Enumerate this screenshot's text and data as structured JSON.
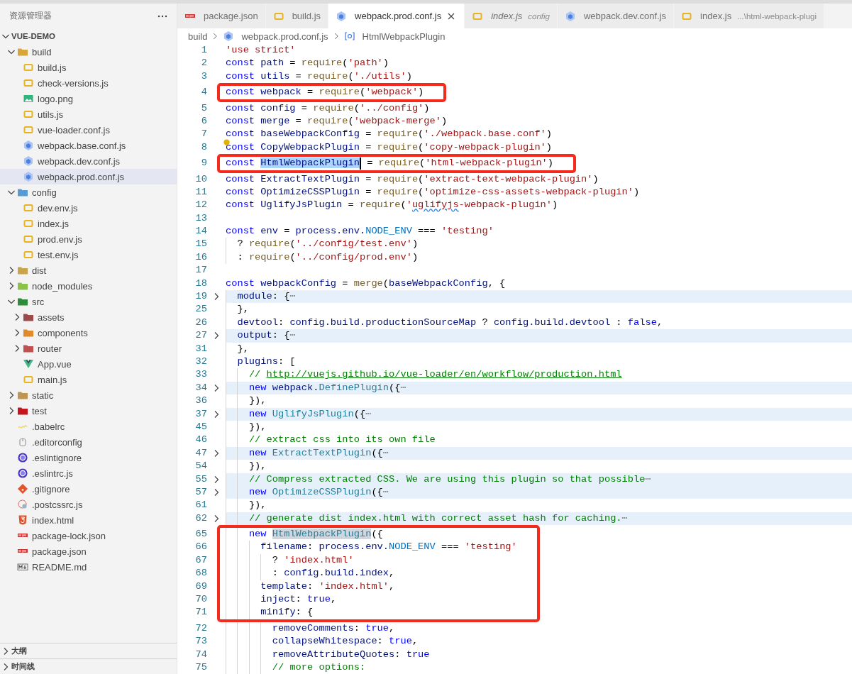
{
  "explorer": {
    "title": "资源管理器",
    "root": {
      "label": "VUE-DEMO",
      "expanded": true,
      "children": [
        {
          "label": "build",
          "kind": "folder",
          "color": "#d9a53a",
          "expanded": true,
          "selected": false,
          "children": [
            {
              "label": "build.js",
              "kind": "js",
              "selected": false
            },
            {
              "label": "check-versions.js",
              "kind": "js",
              "selected": false
            },
            {
              "label": "logo.png",
              "kind": "image",
              "selected": false
            },
            {
              "label": "utils.js",
              "kind": "js",
              "selected": false
            },
            {
              "label": "vue-loader.conf.js",
              "kind": "js",
              "selected": false
            },
            {
              "label": "webpack.base.conf.js",
              "kind": "webpack",
              "selected": false
            },
            {
              "label": "webpack.dev.conf.js",
              "kind": "webpack",
              "selected": false
            },
            {
              "label": "webpack.prod.conf.js",
              "kind": "webpack",
              "selected": true
            }
          ]
        },
        {
          "label": "config",
          "kind": "folder",
          "color": "#5b9bd5",
          "expanded": true,
          "selected": false,
          "children": [
            {
              "label": "dev.env.js",
              "kind": "js",
              "selected": false
            },
            {
              "label": "index.js",
              "kind": "js",
              "selected": false
            },
            {
              "label": "prod.env.js",
              "kind": "js",
              "selected": false
            },
            {
              "label": "test.env.js",
              "kind": "js",
              "selected": false
            }
          ]
        },
        {
          "label": "dist",
          "kind": "folder",
          "color": "#c9a54a",
          "expanded": false,
          "selected": false
        },
        {
          "label": "node_modules",
          "kind": "folder",
          "color": "#8bc34a",
          "expanded": false,
          "selected": false
        },
        {
          "label": "src",
          "kind": "folder",
          "color": "#2e8b3a",
          "expanded": true,
          "selected": false,
          "children": [
            {
              "label": "assets",
              "kind": "folder",
              "color": "#9c4a4a",
              "expanded": false,
              "selected": false
            },
            {
              "label": "components",
              "kind": "folder",
              "color": "#e08a2c",
              "expanded": false,
              "selected": false
            },
            {
              "label": "router",
              "kind": "folder",
              "color": "#c0504d",
              "expanded": false,
              "selected": false
            },
            {
              "label": "App.vue",
              "kind": "vue",
              "selected": false
            },
            {
              "label": "main.js",
              "kind": "js",
              "selected": false
            }
          ]
        },
        {
          "label": "static",
          "kind": "folder",
          "color": "#c09553",
          "expanded": false,
          "selected": false
        },
        {
          "label": "test",
          "kind": "folder",
          "color": "#c4161c",
          "expanded": false,
          "selected": false
        },
        {
          "label": ".babelrc",
          "kind": "babel",
          "selected": false
        },
        {
          "label": ".editorconfig",
          "kind": "editorconfig",
          "selected": false
        },
        {
          "label": ".eslintignore",
          "kind": "eslint",
          "selected": false
        },
        {
          "label": ".eslintrc.js",
          "kind": "eslint",
          "selected": false
        },
        {
          "label": ".gitignore",
          "kind": "git",
          "selected": false
        },
        {
          "label": ".postcssrc.js",
          "kind": "postcss",
          "selected": false
        },
        {
          "label": "index.html",
          "kind": "html",
          "selected": false
        },
        {
          "label": "package-lock.json",
          "kind": "npm",
          "selected": false
        },
        {
          "label": "package.json",
          "kind": "npm",
          "selected": false
        },
        {
          "label": "README.md",
          "kind": "markdown",
          "selected": false
        }
      ]
    },
    "panels": [
      {
        "label": "大纲",
        "expanded": false
      },
      {
        "label": "时间线",
        "expanded": false
      }
    ]
  },
  "tabs": [
    {
      "label": "package.json",
      "kind": "npm",
      "selected": false,
      "preview": false
    },
    {
      "label": "build.js",
      "kind": "js",
      "selected": false,
      "preview": false
    },
    {
      "label": "webpack.prod.conf.js",
      "kind": "webpack",
      "selected": true,
      "preview": false
    },
    {
      "label": "index.js",
      "description": "config",
      "kind": "js",
      "selected": false,
      "preview": true
    },
    {
      "label": "webpack.dev.conf.js",
      "kind": "webpack",
      "selected": false,
      "preview": false
    },
    {
      "label": "index.js",
      "description": "...\\html-webpack-plugi",
      "kind": "js",
      "selected": false,
      "preview": false
    }
  ],
  "breadcrumbs": [
    {
      "label": "build",
      "kind": "folder"
    },
    {
      "label": "webpack.prod.conf.js",
      "kind": "webpack"
    },
    {
      "label": "HtmlWebpackPlugin",
      "kind": "symbol"
    }
  ],
  "editor": {
    "lines": [
      {
        "number": "1",
        "boxed": false,
        "folded": false,
        "tokens": [
          {
            "kind": "string",
            "text": "'use strict'"
          }
        ]
      },
      {
        "number": "2",
        "boxed": false,
        "folded": false,
        "tokens": [
          {
            "kind": "keyword",
            "text": "const "
          },
          {
            "kind": "variable",
            "text": "path"
          },
          {
            "kind": "plain",
            "text": " = "
          },
          {
            "kind": "function",
            "text": "require"
          },
          {
            "kind": "plain",
            "text": "("
          },
          {
            "kind": "string",
            "text": "'path'"
          },
          {
            "kind": "plain",
            "text": ")"
          }
        ]
      },
      {
        "number": "3",
        "boxed": false,
        "folded": false,
        "tokens": [
          {
            "kind": "keyword",
            "text": "const "
          },
          {
            "kind": "variable",
            "text": "utils"
          },
          {
            "kind": "plain",
            "text": " = "
          },
          {
            "kind": "function",
            "text": "require"
          },
          {
            "kind": "plain",
            "text": "("
          },
          {
            "kind": "string",
            "text": "'./utils'"
          },
          {
            "kind": "plain",
            "text": ")"
          }
        ]
      },
      {
        "number": "4",
        "boxed": true,
        "folded": false,
        "tokens": [
          {
            "kind": "keyword",
            "text": "const "
          },
          {
            "kind": "variable",
            "text": "webpack"
          },
          {
            "kind": "plain",
            "text": " = "
          },
          {
            "kind": "function",
            "text": "require"
          },
          {
            "kind": "plain",
            "text": "("
          },
          {
            "kind": "string",
            "text": "'webpack'"
          },
          {
            "kind": "plain",
            "text": ")"
          }
        ]
      },
      {
        "number": "5",
        "boxed": false,
        "folded": false,
        "tokens": [
          {
            "kind": "keyword",
            "text": "const "
          },
          {
            "kind": "variable",
            "text": "config"
          },
          {
            "kind": "plain",
            "text": " = "
          },
          {
            "kind": "function",
            "text": "require"
          },
          {
            "kind": "plain",
            "text": "("
          },
          {
            "kind": "string",
            "text": "'../config'"
          },
          {
            "kind": "plain",
            "text": ")"
          }
        ]
      },
      {
        "number": "6",
        "boxed": false,
        "folded": false,
        "tokens": [
          {
            "kind": "keyword",
            "text": "const "
          },
          {
            "kind": "variable",
            "text": "merge"
          },
          {
            "kind": "plain",
            "text": " = "
          },
          {
            "kind": "function",
            "text": "require"
          },
          {
            "kind": "plain",
            "text": "("
          },
          {
            "kind": "string",
            "text": "'webpack-merge'"
          },
          {
            "kind": "plain",
            "text": ")"
          }
        ]
      },
      {
        "number": "7",
        "boxed": false,
        "folded": false,
        "tokens": [
          {
            "kind": "keyword",
            "text": "const "
          },
          {
            "kind": "variable",
            "text": "baseWebpackConfig"
          },
          {
            "kind": "plain",
            "text": " = "
          },
          {
            "kind": "function",
            "text": "require"
          },
          {
            "kind": "plain",
            "text": "("
          },
          {
            "kind": "string",
            "text": "'./webpack.base.conf'"
          },
          {
            "kind": "plain",
            "text": ")"
          }
        ]
      },
      {
        "number": "8",
        "boxed": false,
        "folded": false,
        "lightbulb": true,
        "tokens": [
          {
            "kind": "keyword",
            "text": "const "
          },
          {
            "kind": "variable",
            "text": "CopyWebpackPlugin"
          },
          {
            "kind": "plain",
            "text": " = "
          },
          {
            "kind": "function",
            "text": "require"
          },
          {
            "kind": "plain",
            "text": "("
          },
          {
            "kind": "string",
            "text": "'copy-webpack-plugin'"
          },
          {
            "kind": "plain",
            "text": ")"
          }
        ]
      },
      {
        "number": "9",
        "boxed": true,
        "folded": false,
        "tokens": [
          {
            "kind": "keyword",
            "text": "const "
          },
          {
            "kind": "variable",
            "text": "HtmlWebpackPlugin",
            "selected": true
          },
          {
            "kind": "plain",
            "text": " = "
          },
          {
            "kind": "function",
            "text": "require"
          },
          {
            "kind": "plain",
            "text": "("
          },
          {
            "kind": "string",
            "text": "'html-webpack-plugin'"
          },
          {
            "kind": "plain",
            "text": ")"
          }
        ]
      },
      {
        "number": "10",
        "boxed": false,
        "folded": false,
        "tokens": [
          {
            "kind": "keyword",
            "text": "const "
          },
          {
            "kind": "variable",
            "text": "ExtractTextPlugin"
          },
          {
            "kind": "plain",
            "text": " = "
          },
          {
            "kind": "function",
            "text": "require"
          },
          {
            "kind": "plain",
            "text": "("
          },
          {
            "kind": "string",
            "text": "'extract-text-webpack-plugin'"
          },
          {
            "kind": "plain",
            "text": ")"
          }
        ]
      },
      {
        "number": "11",
        "boxed": false,
        "folded": false,
        "tokens": [
          {
            "kind": "keyword",
            "text": "const "
          },
          {
            "kind": "variable",
            "text": "OptimizeCSSPlugin"
          },
          {
            "kind": "plain",
            "text": " = "
          },
          {
            "kind": "function",
            "text": "require"
          },
          {
            "kind": "plain",
            "text": "("
          },
          {
            "kind": "string",
            "text": "'optimize-css-assets-webpack-plugin'"
          },
          {
            "kind": "plain",
            "text": ")"
          }
        ]
      },
      {
        "number": "12",
        "boxed": false,
        "folded": false,
        "tokens": [
          {
            "kind": "keyword",
            "text": "const "
          },
          {
            "kind": "variable",
            "text": "UglifyJsPlugin"
          },
          {
            "kind": "plain",
            "text": " = "
          },
          {
            "kind": "function",
            "text": "require"
          },
          {
            "kind": "plain",
            "text": "("
          },
          {
            "kind": "string",
            "text": "'"
          },
          {
            "kind": "string",
            "text": "uglifyjs",
            "squiggle": true
          },
          {
            "kind": "string",
            "text": "-webpack-plugin'"
          },
          {
            "kind": "plain",
            "text": ")"
          }
        ]
      },
      {
        "number": "13",
        "boxed": false,
        "folded": false
      },
      {
        "number": "14",
        "boxed": false,
        "folded": false,
        "tokens": [
          {
            "kind": "keyword",
            "text": "const "
          },
          {
            "kind": "variable",
            "text": "env"
          },
          {
            "kind": "plain",
            "text": " = "
          },
          {
            "kind": "variable",
            "text": "process.env."
          },
          {
            "kind": "constant",
            "text": "NODE_ENV"
          },
          {
            "kind": "plain",
            "text": " === "
          },
          {
            "kind": "string",
            "text": "'testing'"
          }
        ]
      },
      {
        "number": "15",
        "boxed": false,
        "folded": false,
        "tokens": [
          {
            "kind": "plain",
            "text": "  ? "
          },
          {
            "kind": "function",
            "text": "require"
          },
          {
            "kind": "plain",
            "text": "("
          },
          {
            "kind": "string",
            "text": "'../config/test.env'"
          },
          {
            "kind": "plain",
            "text": ")"
          }
        ]
      },
      {
        "number": "16",
        "boxed": false,
        "folded": false,
        "tokens": [
          {
            "kind": "plain",
            "text": "  : "
          },
          {
            "kind": "function",
            "text": "require"
          },
          {
            "kind": "plain",
            "text": "("
          },
          {
            "kind": "string",
            "text": "'../config/prod.env'"
          },
          {
            "kind": "plain",
            "text": ")"
          }
        ]
      },
      {
        "number": "17",
        "boxed": false,
        "folded": false
      },
      {
        "number": "18",
        "boxed": false,
        "folded": false,
        "tokens": [
          {
            "kind": "keyword",
            "text": "const "
          },
          {
            "kind": "variable",
            "text": "webpackConfig"
          },
          {
            "kind": "plain",
            "text": " = "
          },
          {
            "kind": "function",
            "text": "merge"
          },
          {
            "kind": "plain",
            "text": "("
          },
          {
            "kind": "variable",
            "text": "baseWebpackConfig"
          },
          {
            "kind": "plain",
            "text": ", {"
          }
        ]
      },
      {
        "number": "19",
        "boxed": false,
        "folded": true,
        "tokens": [
          {
            "kind": "variable",
            "text": "  module"
          },
          {
            "kind": "plain",
            "text": ": {"
          },
          {
            "kind": "fold",
            "text": "⋯"
          }
        ]
      },
      {
        "number": "25",
        "boxed": false,
        "folded": false,
        "tokens": [
          {
            "kind": "plain",
            "text": "  },"
          }
        ]
      },
      {
        "number": "26",
        "boxed": false,
        "folded": false,
        "tokens": [
          {
            "kind": "variable",
            "text": "  devtool"
          },
          {
            "kind": "plain",
            "text": ": "
          },
          {
            "kind": "variable",
            "text": "config.build.productionSourceMap"
          },
          {
            "kind": "plain",
            "text": " ? "
          },
          {
            "kind": "variable",
            "text": "config.build.devtool"
          },
          {
            "kind": "plain",
            "text": " : "
          },
          {
            "kind": "keyword",
            "text": "false"
          },
          {
            "kind": "plain",
            "text": ","
          }
        ]
      },
      {
        "number": "27",
        "boxed": false,
        "folded": true,
        "tokens": [
          {
            "kind": "variable",
            "text": "  output"
          },
          {
            "kind": "plain",
            "text": ": {"
          },
          {
            "kind": "fold",
            "text": "⋯"
          }
        ]
      },
      {
        "number": "31",
        "boxed": false,
        "folded": false,
        "tokens": [
          {
            "kind": "plain",
            "text": "  },"
          }
        ]
      },
      {
        "number": "32",
        "boxed": false,
        "folded": false,
        "tokens": [
          {
            "kind": "variable",
            "text": "  plugins"
          },
          {
            "kind": "plain",
            "text": ": ["
          }
        ]
      },
      {
        "number": "33",
        "boxed": false,
        "folded": false,
        "tokens": [
          {
            "kind": "comment",
            "text": "    // "
          },
          {
            "kind": "link",
            "text": "http://vuejs.github.io/vue-loader/en/workflow/production.html"
          }
        ]
      },
      {
        "number": "34",
        "boxed": false,
        "folded": true,
        "tokens": [
          {
            "kind": "keyword",
            "text": "    new "
          },
          {
            "kind": "variable",
            "text": "webpack"
          },
          {
            "kind": "plain",
            "text": "."
          },
          {
            "kind": "class",
            "text": "DefinePlugin"
          },
          {
            "kind": "plain",
            "text": "({"
          },
          {
            "kind": "fold",
            "text": "⋯"
          }
        ]
      },
      {
        "number": "36",
        "boxed": false,
        "folded": false,
        "tokens": [
          {
            "kind": "plain",
            "text": "    }),"
          }
        ]
      },
      {
        "number": "37",
        "boxed": false,
        "folded": true,
        "tokens": [
          {
            "kind": "keyword",
            "text": "    new "
          },
          {
            "kind": "class",
            "text": "UglifyJsPlugin"
          },
          {
            "kind": "plain",
            "text": "({"
          },
          {
            "kind": "fold",
            "text": "⋯"
          }
        ]
      },
      {
        "number": "45",
        "boxed": false,
        "folded": false,
        "tokens": [
          {
            "kind": "plain",
            "text": "    }),"
          }
        ]
      },
      {
        "number": "46",
        "boxed": false,
        "folded": false,
        "tokens": [
          {
            "kind": "comment",
            "text": "    // extract css into its own file"
          }
        ]
      },
      {
        "number": "47",
        "boxed": false,
        "folded": true,
        "tokens": [
          {
            "kind": "keyword",
            "text": "    new "
          },
          {
            "kind": "class",
            "text": "ExtractTextPlugin"
          },
          {
            "kind": "plain",
            "text": "({"
          },
          {
            "kind": "fold",
            "text": "⋯"
          }
        ]
      },
      {
        "number": "54",
        "boxed": false,
        "folded": false,
        "tokens": [
          {
            "kind": "plain",
            "text": "    }),"
          }
        ]
      },
      {
        "number": "55",
        "boxed": false,
        "folded": true,
        "tokens": [
          {
            "kind": "comment",
            "text": "    // Compress extracted CSS. We are using this plugin so that possible"
          },
          {
            "kind": "fold",
            "text": "⋯"
          }
        ]
      },
      {
        "number": "57",
        "boxed": false,
        "folded": true,
        "tokens": [
          {
            "kind": "keyword",
            "text": "    new "
          },
          {
            "kind": "class",
            "text": "OptimizeCSSPlugin"
          },
          {
            "kind": "plain",
            "text": "({"
          },
          {
            "kind": "fold",
            "text": "⋯"
          }
        ]
      },
      {
        "number": "61",
        "boxed": false,
        "folded": false,
        "tokens": [
          {
            "kind": "plain",
            "text": "    }),"
          }
        ]
      },
      {
        "number": "62",
        "boxed": false,
        "folded": true,
        "tokens": [
          {
            "kind": "comment",
            "text": "    // generate dist index.html with correct asset hash for caching."
          },
          {
            "kind": "fold",
            "text": "⋯"
          }
        ]
      },
      {
        "number": "65",
        "boxed": true,
        "folded": false,
        "tokens": [
          {
            "kind": "keyword",
            "text": "    new "
          },
          {
            "kind": "class",
            "text": "HtmlWebpackPlugin",
            "highlighted": true
          },
          {
            "kind": "plain",
            "text": "({"
          }
        ]
      },
      {
        "number": "66",
        "boxed": true,
        "folded": false,
        "tokens": [
          {
            "kind": "variable",
            "text": "      filename"
          },
          {
            "kind": "plain",
            "text": ": "
          },
          {
            "kind": "variable",
            "text": "process.env."
          },
          {
            "kind": "constant",
            "text": "NODE_ENV"
          },
          {
            "kind": "plain",
            "text": " === "
          },
          {
            "kind": "string",
            "text": "'testing'"
          }
        ]
      },
      {
        "number": "67",
        "boxed": true,
        "folded": false,
        "tokens": [
          {
            "kind": "plain",
            "text": "        ? "
          },
          {
            "kind": "string",
            "text": "'index.html'"
          }
        ]
      },
      {
        "number": "68",
        "boxed": true,
        "folded": false,
        "tokens": [
          {
            "kind": "plain",
            "text": "        : "
          },
          {
            "kind": "variable",
            "text": "config.build.index"
          },
          {
            "kind": "plain",
            "text": ","
          }
        ]
      },
      {
        "number": "69",
        "boxed": true,
        "folded": false,
        "tokens": [
          {
            "kind": "variable",
            "text": "      template"
          },
          {
            "kind": "plain",
            "text": ": "
          },
          {
            "kind": "string",
            "text": "'index.html'"
          },
          {
            "kind": "plain",
            "text": ","
          }
        ]
      },
      {
        "number": "70",
        "boxed": true,
        "folded": false,
        "tokens": [
          {
            "kind": "variable",
            "text": "      inject"
          },
          {
            "kind": "plain",
            "text": ": "
          },
          {
            "kind": "keyword",
            "text": "true"
          },
          {
            "kind": "plain",
            "text": ","
          }
        ]
      },
      {
        "number": "71",
        "boxed": true,
        "folded": false,
        "tokens": [
          {
            "kind": "variable",
            "text": "      minify"
          },
          {
            "kind": "plain",
            "text": ": {"
          }
        ]
      },
      {
        "number": "72",
        "boxed": false,
        "folded": false,
        "tokens": [
          {
            "kind": "variable",
            "text": "        removeComments"
          },
          {
            "kind": "plain",
            "text": ": "
          },
          {
            "kind": "keyword",
            "text": "true"
          },
          {
            "kind": "plain",
            "text": ","
          }
        ]
      },
      {
        "number": "73",
        "boxed": false,
        "folded": false,
        "tokens": [
          {
            "kind": "variable",
            "text": "        collapseWhitespace"
          },
          {
            "kind": "plain",
            "text": ": "
          },
          {
            "kind": "keyword",
            "text": "true"
          },
          {
            "kind": "plain",
            "text": ","
          }
        ]
      },
      {
        "number": "74",
        "boxed": false,
        "folded": false,
        "tokens": [
          {
            "kind": "variable",
            "text": "        removeAttributeQuotes"
          },
          {
            "kind": "plain",
            "text": ": "
          },
          {
            "kind": "keyword",
            "text": "true"
          }
        ]
      },
      {
        "number": "75",
        "boxed": false,
        "folded": false,
        "tokens": [
          {
            "kind": "comment",
            "text": "        // more options:"
          }
        ]
      }
    ]
  }
}
